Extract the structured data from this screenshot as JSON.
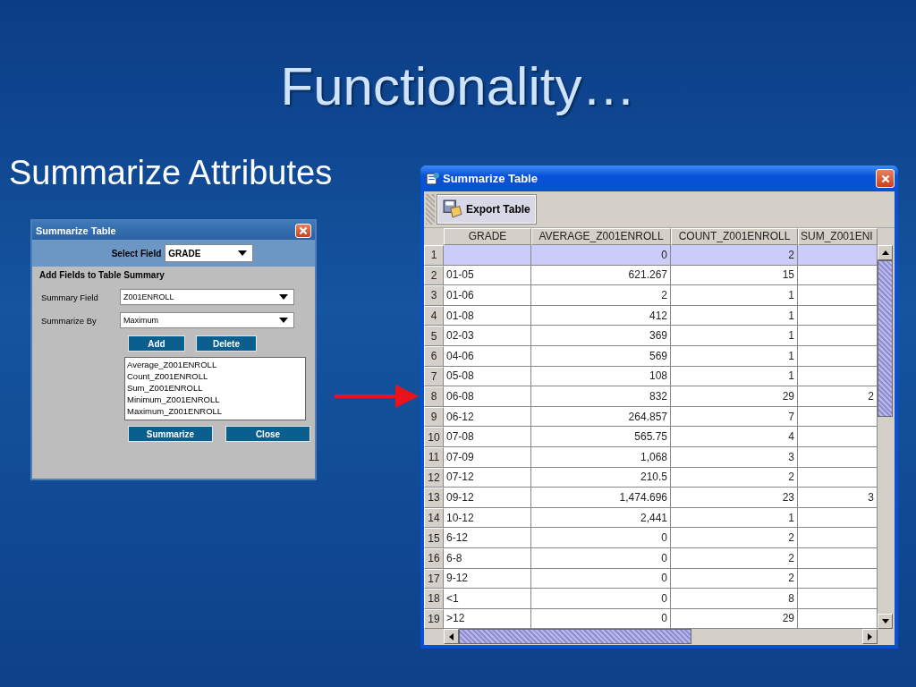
{
  "slide": {
    "title": "Functionality…",
    "subtitle": "Summarize Attributes"
  },
  "dialog": {
    "title": "Summarize Table",
    "select_field": {
      "label": "Select Field",
      "value": "GRADE"
    },
    "section_title": "Add Fields to Table Summary",
    "fields": [
      {
        "label": "Summary Field",
        "value": "Z001ENROLL"
      },
      {
        "label": "Summarize By",
        "value": "Maximum"
      }
    ],
    "edit_buttons": [
      "Add",
      "Delete"
    ],
    "summary_list": [
      "Average_Z001ENROLL",
      "Count_Z001ENROLL",
      "Sum_Z001ENROLL",
      "Minimum_Z001ENROLL",
      "Maximum_Z001ENROLL"
    ],
    "action_buttons": [
      "Summarize",
      "Close"
    ]
  },
  "table_window": {
    "title": "Summarize Table",
    "toolbar_button": "Export Table",
    "columns": [
      "GRADE",
      "AVERAGE_Z001ENROLL",
      "COUNT_Z001ENROLL",
      "SUM_Z001ENI"
    ],
    "rows": [
      {
        "num": "1",
        "average": "0",
        "count": "2",
        "selected": true
      },
      {
        "num": "2",
        "grade": "01-05",
        "average": "621.267",
        "count": "15",
        "selected": false
      },
      {
        "num": "3",
        "grade": "01-06",
        "average": "2",
        "count": "1",
        "selected": false
      },
      {
        "num": "4",
        "grade": "01-08",
        "average": "412",
        "count": "1",
        "selected": false
      },
      {
        "num": "5",
        "grade": "02-03",
        "average": "369",
        "count": "1",
        "selected": false
      },
      {
        "num": "6",
        "grade": "04-06",
        "average": "569",
        "count": "1",
        "selected": false
      },
      {
        "num": "7",
        "grade": "05-08",
        "average": "108",
        "count": "1",
        "selected": false
      },
      {
        "num": "8",
        "grade": "06-08",
        "average": "832",
        "count": "29",
        "sum": "2",
        "selected": false
      },
      {
        "num": "9",
        "grade": "06-12",
        "average": "264.857",
        "count": "7",
        "selected": false
      },
      {
        "num": "10",
        "grade": "07-08",
        "average": "565.75",
        "count": "4",
        "selected": false
      },
      {
        "num": "11",
        "grade": "07-09",
        "average": "1,068",
        "count": "3",
        "selected": false
      },
      {
        "num": "12",
        "grade": "07-12",
        "average": "210.5",
        "count": "2",
        "selected": false
      },
      {
        "num": "13",
        "grade": "09-12",
        "average": "1,474.696",
        "count": "23",
        "sum": "3",
        "selected": false
      },
      {
        "num": "14",
        "grade": "10-12",
        "average": "2,441",
        "count": "1",
        "selected": false
      },
      {
        "num": "15",
        "grade": "6-12",
        "average": "0",
        "count": "2",
        "selected": false
      },
      {
        "num": "16",
        "grade": "6-8",
        "average": "0",
        "count": "2",
        "selected": false
      },
      {
        "num": "17",
        "grade": "9-12",
        "average": "0",
        "count": "2",
        "selected": false
      },
      {
        "num": "18",
        "grade": "<1",
        "average": "0",
        "count": "8",
        "selected": false
      },
      {
        "num": "19",
        "grade": ">12",
        "average": "0",
        "count": "29",
        "selected": false
      }
    ]
  }
}
